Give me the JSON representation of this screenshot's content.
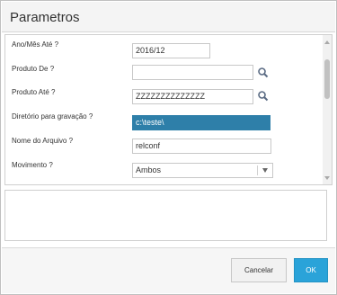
{
  "dialog": {
    "title": "Parametros"
  },
  "form": {
    "fields": [
      {
        "label": "Ano/Mês Até ?",
        "value": "2016/12",
        "type": "text"
      },
      {
        "label": "Produto De ?",
        "value": "",
        "type": "search"
      },
      {
        "label": "Produto Até ?",
        "value": "ZZZZZZZZZZZZZZ",
        "type": "search"
      },
      {
        "label": "Diretório para gravação ?",
        "value": "c:\\teste\\",
        "type": "text",
        "selected": true
      },
      {
        "label": "Nome do Arquivo ?",
        "value": "relconf",
        "type": "text"
      },
      {
        "label": "Movimento ?",
        "value": "Ambos",
        "type": "select"
      }
    ]
  },
  "footer": {
    "cancel_label": "Cancelar",
    "ok_label": "OK"
  },
  "icons": {
    "search": "magnifier-icon",
    "dropdown": "chevron-down-icon"
  },
  "colors": {
    "accent": "#2aa3d9",
    "selection": "#2e7fa9"
  }
}
